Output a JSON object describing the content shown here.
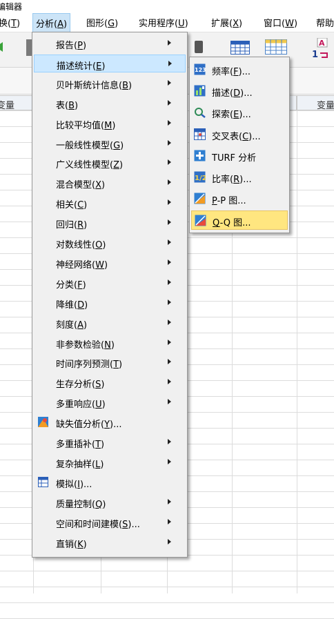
{
  "window": {
    "title": "编辑器"
  },
  "menubar": [
    {
      "label": "换",
      "key": "T"
    },
    {
      "label": "分析",
      "key": "A"
    },
    {
      "label": "图形",
      "key": "G"
    },
    {
      "label": "实用程序",
      "key": "U"
    },
    {
      "label": "扩展",
      "key": "X"
    },
    {
      "label": "窗口",
      "key": "W"
    },
    {
      "label": "帮助",
      "key": ""
    }
  ],
  "grid": {
    "col_header_left": "变量",
    "col_header_right": "变量"
  },
  "analyze_menu": {
    "items": [
      {
        "label": "报告",
        "key": "P",
        "submenu": true
      },
      {
        "label": "描述统计",
        "key": "E",
        "submenu": true,
        "highlighted": true
      },
      {
        "label": "贝叶斯统计信息",
        "key": "B",
        "submenu": true
      },
      {
        "label": "表",
        "key": "B",
        "submenu": true
      },
      {
        "label": "比较平均值",
        "key": "M",
        "submenu": true
      },
      {
        "label": "一般线性模型",
        "key": "G",
        "submenu": true
      },
      {
        "label": "广义线性模型",
        "key": "Z",
        "submenu": true
      },
      {
        "label": "混合模型",
        "key": "X",
        "submenu": true
      },
      {
        "label": "相关",
        "key": "C",
        "submenu": true
      },
      {
        "label": "回归",
        "key": "R",
        "submenu": true
      },
      {
        "label": "对数线性",
        "key": "O",
        "submenu": true
      },
      {
        "label": "神经网络",
        "key": "W",
        "submenu": true
      },
      {
        "label": "分类",
        "key": "F",
        "submenu": true
      },
      {
        "label": "降维",
        "key": "D",
        "submenu": true
      },
      {
        "label": "刻度",
        "key": "A",
        "submenu": true
      },
      {
        "label": "非参数检验",
        "key": "N",
        "submenu": true
      },
      {
        "label": "时间序列预测",
        "key": "T",
        "submenu": true
      },
      {
        "label": "生存分析",
        "key": "S",
        "submenu": true
      },
      {
        "label": "多重响应",
        "key": "U",
        "submenu": true
      },
      {
        "label": "缺失值分析",
        "key": "Y",
        "suffix": "...",
        "submenu": false,
        "icon": "missing-value-icon"
      },
      {
        "label": "多重插补",
        "key": "T",
        "submenu": true
      },
      {
        "label": "复杂抽样",
        "key": "L",
        "submenu": true
      },
      {
        "label": "模拟",
        "key": "I",
        "suffix": "...",
        "submenu": false,
        "icon": "simulation-icon"
      },
      {
        "label": "质量控制",
        "key": "Q",
        "submenu": true
      },
      {
        "label": "空间和时间建模",
        "key": "S",
        "suffix": "...",
        "submenu": true
      },
      {
        "label": "直销",
        "key": "K",
        "submenu": true
      }
    ]
  },
  "descriptive_submenu": {
    "items": [
      {
        "label": "频率",
        "key": "F",
        "suffix": "...",
        "icon": "frequencies-icon"
      },
      {
        "label": "描述",
        "key": "D",
        "suffix": "...",
        "icon": "descriptives-icon"
      },
      {
        "label": "探索",
        "key": "E",
        "suffix": "...",
        "icon": "explore-icon"
      },
      {
        "label": "交叉表",
        "key": "C",
        "suffix": "...",
        "icon": "crosstabs-icon"
      },
      {
        "label": "TURF 分析",
        "key": "",
        "suffix": "",
        "icon": "turf-icon"
      },
      {
        "label": "比率",
        "key": "R",
        "suffix": "...",
        "icon": "ratio-icon"
      },
      {
        "label": "-P 图...",
        "key": "P",
        "prefix_key": true,
        "icon": "pp-plot-icon"
      },
      {
        "label": "-Q 图...",
        "key": "Q",
        "prefix_key": true,
        "icon": "qq-plot-icon",
        "highlighted": true
      }
    ]
  },
  "colors": {
    "menu_bg": "#f0f0f0",
    "highlight_blue": "#cce8ff",
    "highlight_yellow": "#ffe680"
  }
}
